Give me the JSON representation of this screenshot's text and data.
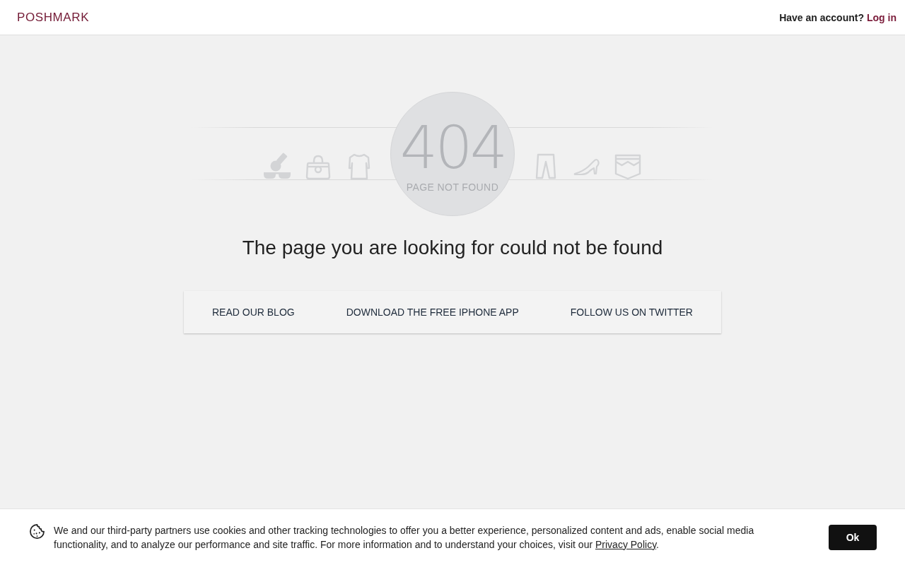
{
  "header": {
    "logo": "POSHMARK",
    "account_prompt": "Have an account?",
    "login_link": "Log in"
  },
  "error": {
    "code": "404",
    "caption": "PAGE NOT FOUND",
    "message": "The page you are looking for could not be found"
  },
  "links": [
    "READ OUR BLOG",
    "DOWNLOAD THE FREE IPHONE APP",
    "FOLLOW US ON TWITTER"
  ],
  "cookie_banner": {
    "text": "We and our third-party partners use cookies and other tracking technologies to offer you a better experience, personalized content and ads, enable social media functionality, and to analyze our performance and site traffic. For more information and to understand your choices, visit our",
    "link": "Privacy Policy",
    "text_end": ".",
    "button": "Ok"
  }
}
